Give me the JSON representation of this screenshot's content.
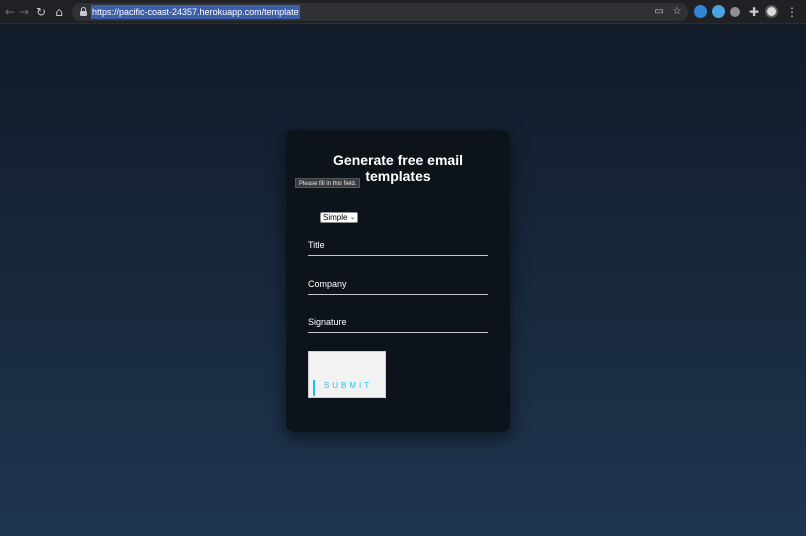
{
  "browser": {
    "url": "https://pacific-coast-24357.herokuapp.com/template",
    "icons": {
      "back": "arrow-left-icon",
      "forward": "arrow-right-icon",
      "reload": "reload-icon",
      "home": "home-icon",
      "lock": "lock-icon",
      "cast": "cast-icon",
      "bookmark": "star-icon",
      "extensions": [
        "shield-extension-icon",
        "blue-extension-icon",
        "gray-extension-icon",
        "puzzle-icon",
        "profile-avatar-icon"
      ],
      "menu": "kebab-menu-icon"
    }
  },
  "card": {
    "title": "Generate free email templates",
    "tooltip": "Please fill in this field.",
    "template_select": {
      "selected": "Simple"
    },
    "fields": [
      {
        "placeholder": "Title"
      },
      {
        "placeholder": "Company"
      },
      {
        "placeholder": "Signature"
      }
    ],
    "submit_label": "SUBMIT"
  },
  "colors": {
    "background_top": "#111a26",
    "background_bottom": "#1f3650",
    "card": "#0c131b",
    "accent": "#20c5e6",
    "url_highlight": "#3d5ea8"
  }
}
